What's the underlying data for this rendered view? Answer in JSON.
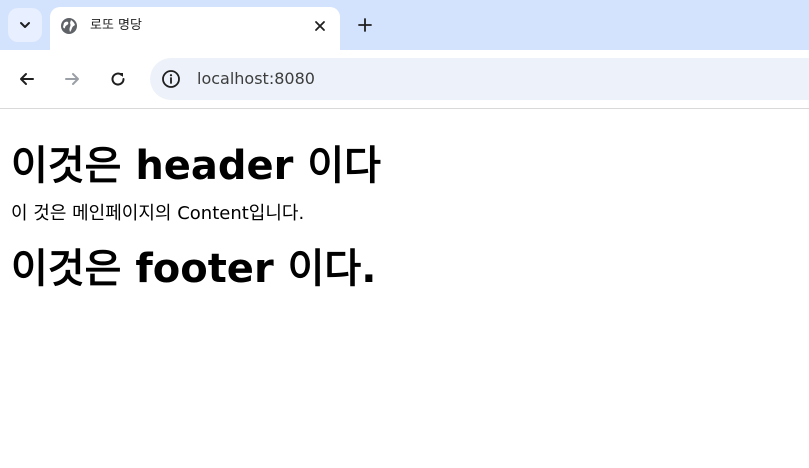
{
  "browser": {
    "tab": {
      "title": "로또 명당"
    },
    "address": {
      "url": "localhost:8080"
    }
  },
  "page": {
    "header": "이것은 header 이다",
    "content": "이 것은 메인페이지의 Content입니다.",
    "footer": "이것은 footer 이다."
  },
  "colors": {
    "tabbar_bg": "#d3e3fd",
    "omnibox_bg": "#edf2fa"
  }
}
